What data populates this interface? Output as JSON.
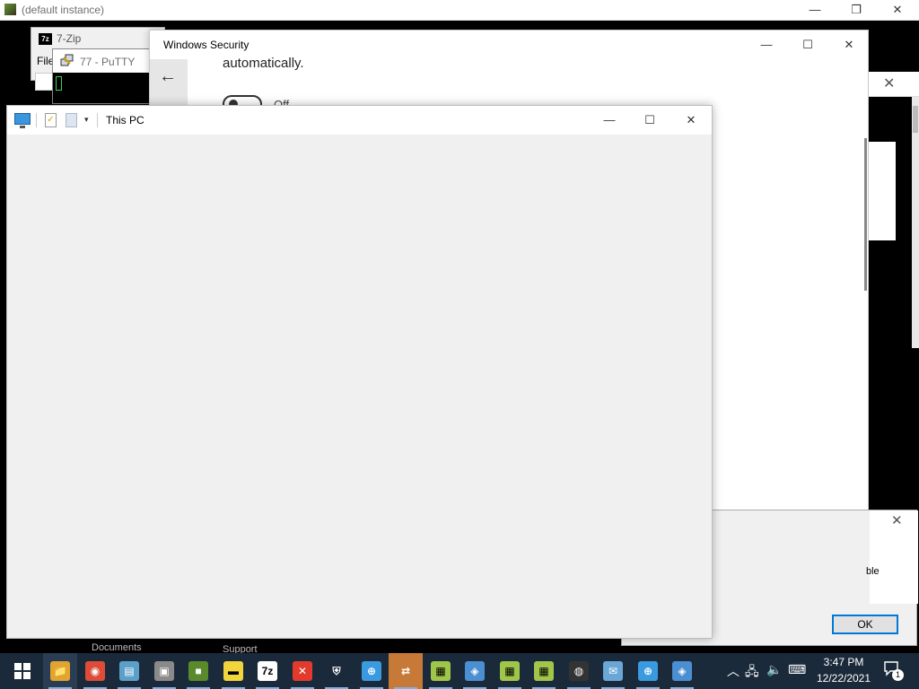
{
  "host": {
    "title": "(default instance)",
    "minimize": "—",
    "restore": "❐",
    "close": "✕"
  },
  "zip": {
    "icon": "7z",
    "title": "7-Zip",
    "menu_file": "File"
  },
  "putty": {
    "title": "77 - PuTTY"
  },
  "security": {
    "title": "Windows Security",
    "text": "automatically.",
    "toggle_label": "Off",
    "minimize": "—",
    "maximize": "☐",
    "close": "✕",
    "back": "←"
  },
  "right_dialog": {
    "close": "✕",
    "partial_text": "ble",
    "ok_label": "OK"
  },
  "this_pc": {
    "title": "This PC",
    "minimize": "—",
    "maximize": "☐",
    "close": "✕",
    "qdrop": "▾"
  },
  "remnants": {
    "documents": "Documents",
    "support": "Support"
  },
  "taskbar": {
    "items": [
      {
        "name": "file-explorer",
        "glyph": "📁",
        "bg": "#e0a431"
      },
      {
        "name": "chrome",
        "glyph": "◉",
        "bg": "#dd4b39"
      },
      {
        "name": "notebook-app",
        "glyph": "▤",
        "bg": "#5ba0c9"
      },
      {
        "name": "network-drive",
        "glyph": "▣",
        "bg": "#8a8a8a"
      },
      {
        "name": "minecraft",
        "glyph": "■",
        "bg": "#5b8a2d"
      },
      {
        "name": "sticky-notes",
        "glyph": "▬",
        "bg": "#f2d43c"
      },
      {
        "name": "7zip",
        "glyph": "7z",
        "bg": "#ffffff"
      },
      {
        "name": "error-app",
        "glyph": "✕",
        "bg": "#e23b2e"
      },
      {
        "name": "windows-security",
        "glyph": "⛨",
        "bg": "#1b2a3a"
      },
      {
        "name": "globe-app",
        "glyph": "⊕",
        "bg": "#3a9ae0"
      },
      {
        "name": "putty",
        "glyph": "⇄",
        "bg": "#c77a37"
      },
      {
        "name": "libreoffice-calc-1",
        "glyph": "▦",
        "bg": "#9fc54a"
      },
      {
        "name": "remote-desktop-1",
        "glyph": "◈",
        "bg": "#4a8fd1"
      },
      {
        "name": "libreoffice-calc-2",
        "glyph": "▦",
        "bg": "#9fc54a"
      },
      {
        "name": "libreoffice-calc-3",
        "glyph": "▦",
        "bg": "#9fc54a"
      },
      {
        "name": "globe-dark",
        "glyph": "◍",
        "bg": "#333333"
      },
      {
        "name": "mail-app",
        "glyph": "✉",
        "bg": "#6aa6d6"
      },
      {
        "name": "globe-app-2",
        "glyph": "⊕",
        "bg": "#3a9ae0"
      },
      {
        "name": "remote-desktop-2",
        "glyph": "◈",
        "bg": "#4a8fd1"
      }
    ],
    "start": "⊞"
  },
  "tray": {
    "chevron": "︿",
    "network": "🖧",
    "volume": "🔈",
    "keyboard": "⌨",
    "time": "3:47 PM",
    "date": "12/22/2021",
    "notif_count": "1"
  }
}
